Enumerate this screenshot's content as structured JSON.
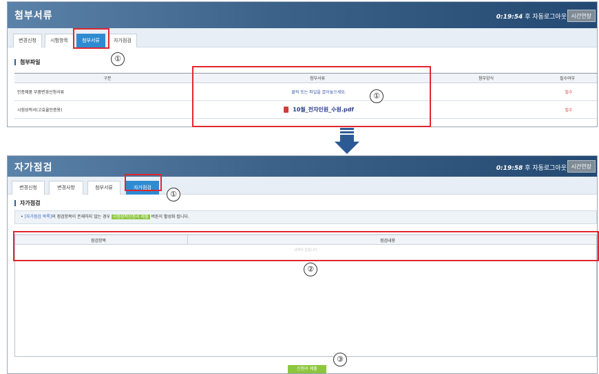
{
  "top": {
    "title": "첨부서류",
    "timer_time": "0:19:54",
    "timer_text": " 후 자동로그아웃",
    "extend_button": "시간연장",
    "tabs": [
      "변경신청",
      "시험항목",
      "첨부서류",
      "자가점검"
    ],
    "active_tab": 2,
    "section_title": "첨부파일",
    "table": {
      "headers": [
        "구분",
        "첨부서류",
        "첨부양식",
        "필수여부"
      ],
      "rows": [
        {
          "category": "인증제품 부품변경신청서류",
          "attachment": "클릭 또는 파일을 끌어놓으세요.",
          "form": "",
          "required": "필수"
        },
        {
          "category": "시험성적서(고효율인증용)",
          "attachment": "10월_전자인원_수원.pdf",
          "form": "",
          "required": "필수"
        }
      ]
    }
  },
  "bottom": {
    "title": "자가점검",
    "timer_time": "0:19:58",
    "timer_text": " 후 자동로그아웃",
    "extend_button": "시간연장",
    "tabs": [
      "변경신청",
      "변경사항",
      "첨부서류",
      "자가점검"
    ],
    "active_tab": 3,
    "section_title": "자가점검",
    "notice": {
      "prefix": "• ",
      "link": "[자가점검 목록]",
      "middle": "의 점검항목이 존재하지 않는 경우 ",
      "highlight": "시험성적신청서 제출",
      "suffix": " 버튼이 활성화 됩니다."
    },
    "grid": {
      "headers": [
        "점검항목",
        "점검내용"
      ],
      "empty_text": "내역이 없습니다"
    },
    "submit_button": "신청서 제출"
  },
  "annotations": {
    "one": "①",
    "two": "②",
    "three": "③"
  }
}
